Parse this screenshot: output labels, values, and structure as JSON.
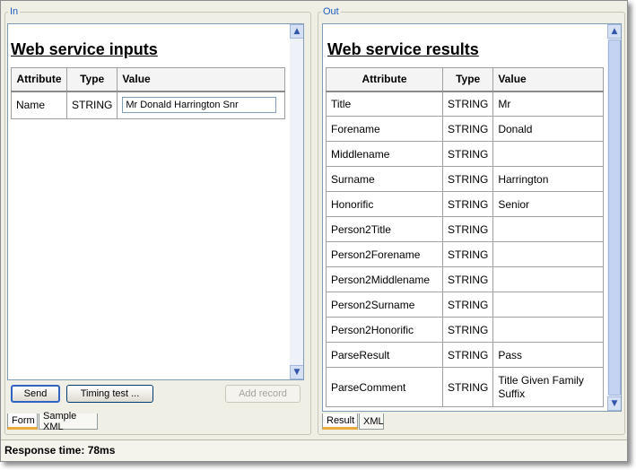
{
  "left_panel": {
    "group_label": "In",
    "title": "Web service inputs",
    "columns": [
      "Attribute",
      "Type",
      "Value"
    ],
    "rows": [
      {
        "attribute": "Name",
        "type": "STRING",
        "value": "Mr Donald Harrington Snr"
      }
    ],
    "buttons": {
      "send": "Send",
      "timing": "Timing test ...",
      "add_record": "Add record"
    },
    "tabs": [
      "Form",
      "Sample XML"
    ]
  },
  "right_panel": {
    "group_label": "Out",
    "title": "Web service results",
    "columns": [
      "Attribute",
      "Type",
      "Value"
    ],
    "rows": [
      {
        "attribute": "Title",
        "type": "STRING",
        "value": "Mr"
      },
      {
        "attribute": "Forename",
        "type": "STRING",
        "value": "Donald"
      },
      {
        "attribute": "Middlename",
        "type": "STRING",
        "value": ""
      },
      {
        "attribute": "Surname",
        "type": "STRING",
        "value": "Harrington"
      },
      {
        "attribute": "Honorific",
        "type": "STRING",
        "value": "Senior"
      },
      {
        "attribute": "Person2Title",
        "type": "STRING",
        "value": ""
      },
      {
        "attribute": "Person2Forename",
        "type": "STRING",
        "value": ""
      },
      {
        "attribute": "Person2Middlename",
        "type": "STRING",
        "value": ""
      },
      {
        "attribute": "Person2Surname",
        "type": "STRING",
        "value": ""
      },
      {
        "attribute": "Person2Honorific",
        "type": "STRING",
        "value": ""
      },
      {
        "attribute": "ParseResult",
        "type": "STRING",
        "value": "Pass"
      },
      {
        "attribute": "ParseComment",
        "type": "STRING",
        "value": "Title Given Family Suffix"
      }
    ],
    "tabs": [
      "Result",
      "XML"
    ]
  },
  "status": {
    "text": "Response time: 78ms"
  },
  "icons": {
    "scroll_up": "scroll-up-arrow-icon",
    "scroll_down": "scroll-down-arrow-icon"
  },
  "colors": {
    "accent": "#1a5dbf",
    "tab_highlight": "#e9a93b"
  }
}
